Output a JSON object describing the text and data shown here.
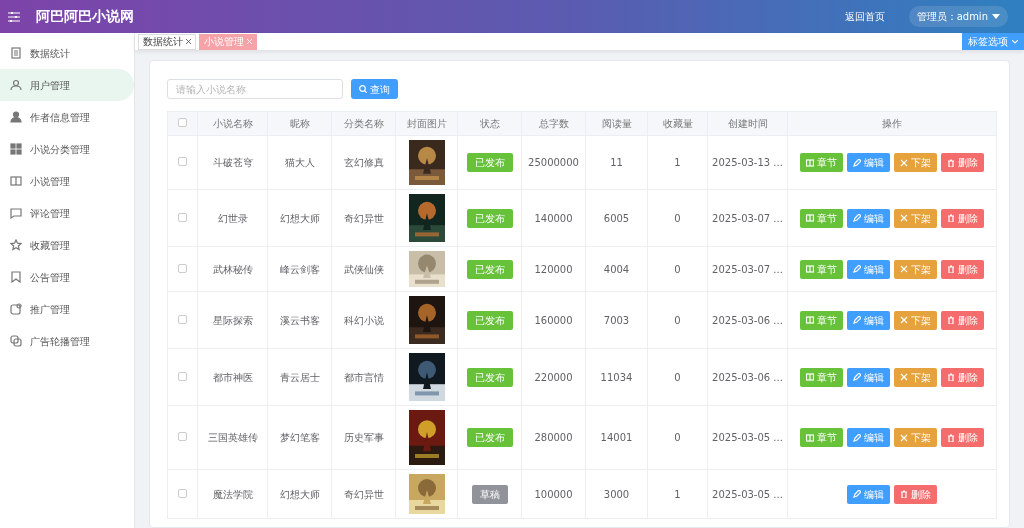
{
  "header": {
    "title": "阿巴阿巴小说网",
    "home_link": "返回首页",
    "user": "管理员：admin"
  },
  "sidebar": {
    "items": [
      {
        "label": "数据统计",
        "selected": false
      },
      {
        "label": "用户管理",
        "selected": true
      },
      {
        "label": "作者信息管理",
        "selected": false
      },
      {
        "label": "小说分类管理",
        "selected": false
      },
      {
        "label": "小说管理",
        "selected": false
      },
      {
        "label": "评论管理",
        "selected": false
      },
      {
        "label": "收藏管理",
        "selected": false
      },
      {
        "label": "公告管理",
        "selected": false
      },
      {
        "label": "推广管理",
        "selected": false
      },
      {
        "label": "广告轮播管理",
        "selected": false
      }
    ]
  },
  "tabs": [
    {
      "label": "数据统计",
      "selected": false
    },
    {
      "label": "小说管理",
      "selected": true
    }
  ],
  "tab_options": "标签选项",
  "search": {
    "placeholder": "请输入小说名称",
    "button": "查询"
  },
  "table": {
    "select_all": {
      "checked": false
    },
    "columns": [
      "小说名称",
      "昵称",
      "分类名称",
      "封面图片",
      "状态",
      "总字数",
      "阅读量",
      "收藏量",
      "创建时间",
      "操作"
    ],
    "rows": [
      {
        "checked": false,
        "name": "斗破苍穹",
        "nickname": "猫大人",
        "category": "玄幻修真",
        "status": {
          "text": "已发布",
          "kind": "published"
        },
        "words": "25000000",
        "reads": "11",
        "favorites": "1",
        "created": "2025-03-13 ...",
        "actions": [
          {
            "kind": "chapters",
            "label": "章节"
          },
          {
            "kind": "edit",
            "label": "编辑"
          },
          {
            "kind": "unpublish",
            "label": "下架"
          },
          {
            "kind": "delete",
            "label": "删除"
          }
        ]
      },
      {
        "checked": false,
        "name": "幻世录",
        "nickname": "幻想大师",
        "category": "奇幻异世",
        "status": {
          "text": "已发布",
          "kind": "published"
        },
        "words": "140000",
        "reads": "6005",
        "favorites": "0",
        "created": "2025-03-07 ...",
        "actions": [
          {
            "kind": "chapters",
            "label": "章节"
          },
          {
            "kind": "edit",
            "label": "编辑"
          },
          {
            "kind": "unpublish",
            "label": "下架"
          },
          {
            "kind": "delete",
            "label": "删除"
          }
        ]
      },
      {
        "checked": false,
        "name": "武林秘传",
        "nickname": "峰云剑客",
        "category": "武侠仙侠",
        "status": {
          "text": "已发布",
          "kind": "published"
        },
        "words": "120000",
        "reads": "4004",
        "favorites": "0",
        "created": "2025-03-07 ...",
        "actions": [
          {
            "kind": "chapters",
            "label": "章节"
          },
          {
            "kind": "edit",
            "label": "编辑"
          },
          {
            "kind": "unpublish",
            "label": "下架"
          },
          {
            "kind": "delete",
            "label": "删除"
          }
        ]
      },
      {
        "checked": false,
        "name": "星际探索",
        "nickname": "溪云书客",
        "category": "科幻小说",
        "status": {
          "text": "已发布",
          "kind": "published"
        },
        "words": "160000",
        "reads": "7003",
        "favorites": "0",
        "created": "2025-03-06 ...",
        "actions": [
          {
            "kind": "chapters",
            "label": "章节"
          },
          {
            "kind": "edit",
            "label": "编辑"
          },
          {
            "kind": "unpublish",
            "label": "下架"
          },
          {
            "kind": "delete",
            "label": "删除"
          }
        ]
      },
      {
        "checked": false,
        "name": "都市神医",
        "nickname": "青云居士",
        "category": "都市言情",
        "status": {
          "text": "已发布",
          "kind": "published"
        },
        "words": "220000",
        "reads": "11034",
        "favorites": "0",
        "created": "2025-03-06 ...",
        "actions": [
          {
            "kind": "chapters",
            "label": "章节"
          },
          {
            "kind": "edit",
            "label": "编辑"
          },
          {
            "kind": "unpublish",
            "label": "下架"
          },
          {
            "kind": "delete",
            "label": "删除"
          }
        ]
      },
      {
        "checked": false,
        "name": "三国英雄传",
        "nickname": "梦幻笔客",
        "category": "历史军事",
        "status": {
          "text": "已发布",
          "kind": "published"
        },
        "words": "280000",
        "reads": "14001",
        "favorites": "0",
        "created": "2025-03-05 ...",
        "actions": [
          {
            "kind": "chapters",
            "label": "章节"
          },
          {
            "kind": "edit",
            "label": "编辑"
          },
          {
            "kind": "unpublish",
            "label": "下架"
          },
          {
            "kind": "delete",
            "label": "删除"
          }
        ]
      },
      {
        "checked": false,
        "name": "魔法学院",
        "nickname": "幻想大师",
        "category": "奇幻异世",
        "status": {
          "text": "草稿",
          "kind": "draft"
        },
        "words": "100000",
        "reads": "3000",
        "favorites": "1",
        "created": "2025-03-05 ...",
        "actions": [
          {
            "kind": "edit",
            "label": "编辑"
          },
          {
            "kind": "delete",
            "label": "删除"
          }
        ]
      }
    ]
  }
}
